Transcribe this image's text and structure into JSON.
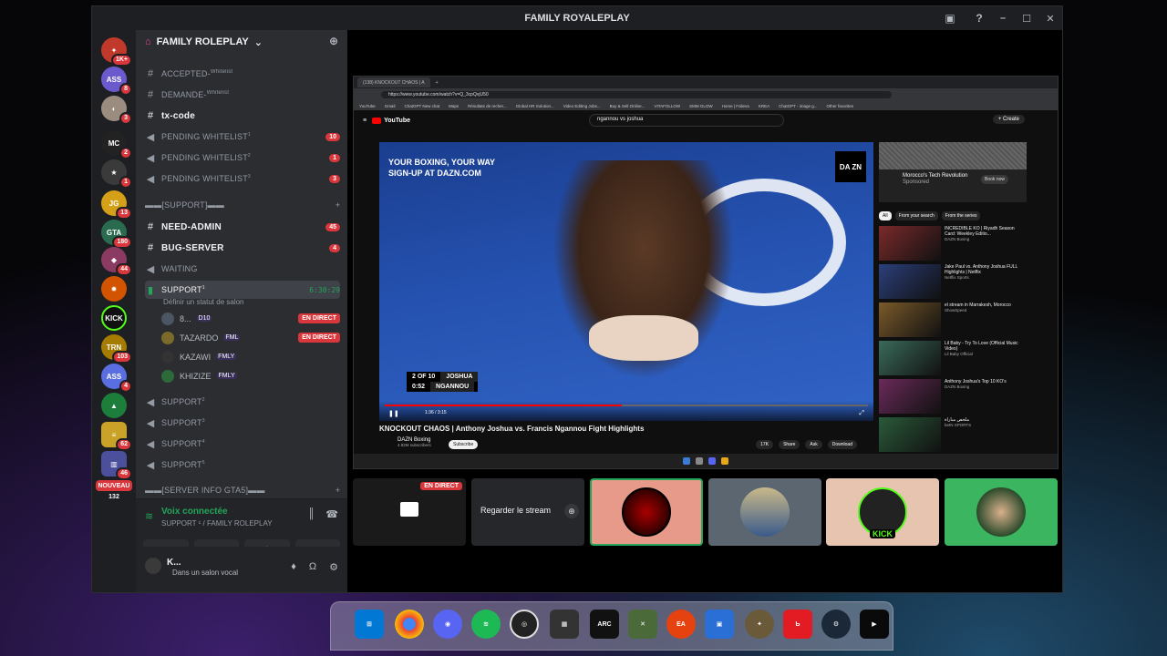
{
  "window": {
    "title": "FAMILY ROYALEPLAY"
  },
  "server": {
    "name": "FAMILY ROLEPLAY"
  },
  "guild_badges": [
    "1K+",
    "8",
    "3",
    "2",
    "1",
    "13",
    "180",
    "44",
    "103",
    "4",
    "62",
    "46",
    "132"
  ],
  "guild_new_label": "NOUVEAU",
  "channels": [
    {
      "sym": "#",
      "name": "ACCEPTED-",
      "suffix": "Whitelist",
      "bold": false
    },
    {
      "sym": "#",
      "name": "DEMANDE-",
      "suffix": "Whitelist",
      "bold": false
    },
    {
      "sym": "#",
      "name": "tx-code",
      "bold": true
    },
    {
      "sym": "🔊",
      "name": "PENDING WHITELIST",
      "suffix": "1",
      "count": "10"
    },
    {
      "sym": "🔊",
      "name": "PENDING WHITELIST",
      "suffix": "2",
      "count": "1"
    },
    {
      "sym": "🔊",
      "name": "PENDING WHITELIST",
      "suffix": "3",
      "count": "3"
    }
  ],
  "category_support": "▬▬[Support]▬▬",
  "channels2": [
    {
      "sym": "#",
      "name": "NEED-ADMIN",
      "count": "45"
    },
    {
      "sym": "#",
      "name": "BUG-SERVER",
      "count": "4"
    },
    {
      "sym": "🔊",
      "name": "WAITING"
    }
  ],
  "active_channel": {
    "name": "SUPPORT",
    "sup": "1",
    "timer": "6:30:29",
    "status": "Définir un statut de salon"
  },
  "voice_users": [
    {
      "name": "8...",
      "tag": "D10",
      "live": ""
    },
    {
      "name": "TAZARDO",
      "tag": "FML",
      "live": "EN DIRECT"
    },
    {
      "name": "KAZAWI",
      "tag": "FMLY",
      "live": ""
    },
    {
      "name": "KHIZIZE",
      "tag": "FMLY",
      "live": ""
    }
  ],
  "live_label": "EN DIRECT",
  "supports": [
    {
      "name": "SUPPORT",
      "sup": "2"
    },
    {
      "name": "SUPPORT",
      "sup": "3"
    },
    {
      "name": "SUPPORT",
      "sup": "4"
    },
    {
      "name": "SUPPORT",
      "sup": "5"
    }
  ],
  "category_info": "▬▬[SERVER INFO GTA5]▬▬",
  "voice_panel": {
    "title": "Voix connectée",
    "sub": "SUPPORT ¹ / FAMILY ROLEPLAY"
  },
  "user": {
    "name": "K...",
    "status": "Dans un salon vocal"
  },
  "browser": {
    "tab": "(138) KNOCKOUT CHAOS | A",
    "url": "https://www.youtube.com/watch?v=Q_3cpQvjU50",
    "bookmarks": [
      "YouTube",
      "Gmail",
      "ChatGPT New chat",
      "Maps",
      "Résultats de recher...",
      "Global HR Solution...",
      "Video Editing Jobs...",
      "Buy & Sell Online...",
      "VITAFOLLOW",
      "SMM GLOW",
      "Home | Folieva",
      "KREA",
      "ChatGPT - image g...",
      "Other favorites"
    ]
  },
  "youtube": {
    "logo": "YouTube",
    "search": "ngannou vs joshua",
    "create": "Create",
    "promo": "YOUR BOXING, YOUR WAY\nSIGN-UP AT DAZN.COM",
    "dazn": "DA ZN",
    "score_round": "2 OF 10",
    "score_time": "0:52",
    "fighter1": "JOSHUA",
    "fighter2": "NGANNOU",
    "time": "1:36 / 3:15",
    "progress": 0.49,
    "title": "KNOCKOUT CHAOS | Anthony Joshua vs. Francis Ngannou Fight Highlights",
    "channel": "DAZN Boxing",
    "subs": "4.92M subscribers",
    "subscribe": "Subscribe",
    "actions": [
      "17K",
      "Share",
      "Ask",
      "Download"
    ],
    "ad": {
      "title": "Morocco's Tech Revolution",
      "sponsor": "Sponsored",
      "btn": "Book now"
    },
    "chips": [
      "All",
      "From your search",
      "From the series"
    ],
    "related": [
      {
        "title": "INCREDIBLE KO | Riyadh Season Card: Weekley Editio...",
        "meta": "DAZN Boxing"
      },
      {
        "title": "Jake Paul vs. Anthony Joshua FULL Highlights | Netflix",
        "meta": "Netflix Sports"
      },
      {
        "title": "el stream in Marrakesh, Morocco",
        "meta": "ShowSpeed"
      },
      {
        "title": "Lil Baby - Try To Love (Official Music Video)",
        "meta": "Lil Baby Official"
      },
      {
        "title": "Anthony Joshua's Top 10 KO's",
        "meta": "DAZN Boxing"
      },
      {
        "title": "ملخص مباراة",
        "meta": "beIN SPORTS"
      }
    ]
  },
  "tiles": {
    "live": "EN DIRECT",
    "watch": "Regarder le stream",
    "kick": "KICK"
  }
}
